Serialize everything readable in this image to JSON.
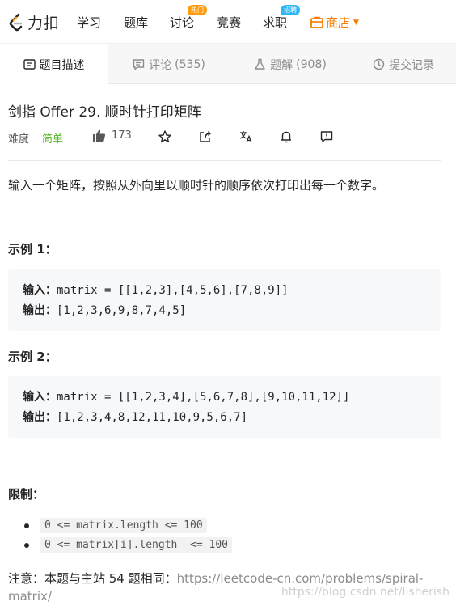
{
  "nav": {
    "logo_text": "力扣",
    "items": [
      "学习",
      "题库",
      "讨论",
      "竞赛",
      "求职"
    ],
    "badges": {
      "discuss": "热门",
      "jobs": "招聘"
    },
    "store": "商店",
    "store_color": "#f57c00"
  },
  "tabs": [
    {
      "label": "题目描述",
      "count": ""
    },
    {
      "label": "评论",
      "count": "(535)"
    },
    {
      "label": "题解",
      "count": "(908)"
    },
    {
      "label": "提交记录",
      "count": ""
    }
  ],
  "problem": {
    "title": "剑指 Offer 29. 顺时针打印矩阵",
    "difficulty_label": "难度",
    "difficulty": "简单",
    "difficulty_color": "#5ab726",
    "likes": "173",
    "description": "输入一个矩阵，按照从外向里以顺时针的顺序依次打印出每一个数字。"
  },
  "examples": [
    {
      "title": "示例 1：",
      "input_label": "输入：",
      "input": "matrix = [[1,2,3],[4,5,6],[7,8,9]]",
      "output_label": "输出：",
      "output": "[1,2,3,6,9,8,7,4,5]"
    },
    {
      "title": "示例 2：",
      "input_label": "输入：",
      "input": "matrix = [[1,2,3,4],[5,6,7,8],[9,10,11,12]]",
      "output_label": "输出：",
      "output": "[1,2,3,4,8,12,11,10,9,5,6,7]"
    }
  ],
  "limits": {
    "title": "限制：",
    "items": [
      "0 <= matrix.length <= 100",
      "0 <= matrix[i].length  <= 100"
    ]
  },
  "note": {
    "text": "注意：本题与主站 54 题相同：",
    "url": "https://leetcode-cn.com/problems/spiral-matrix/"
  },
  "watermark": "https://blog.csdn.net/lisherish"
}
